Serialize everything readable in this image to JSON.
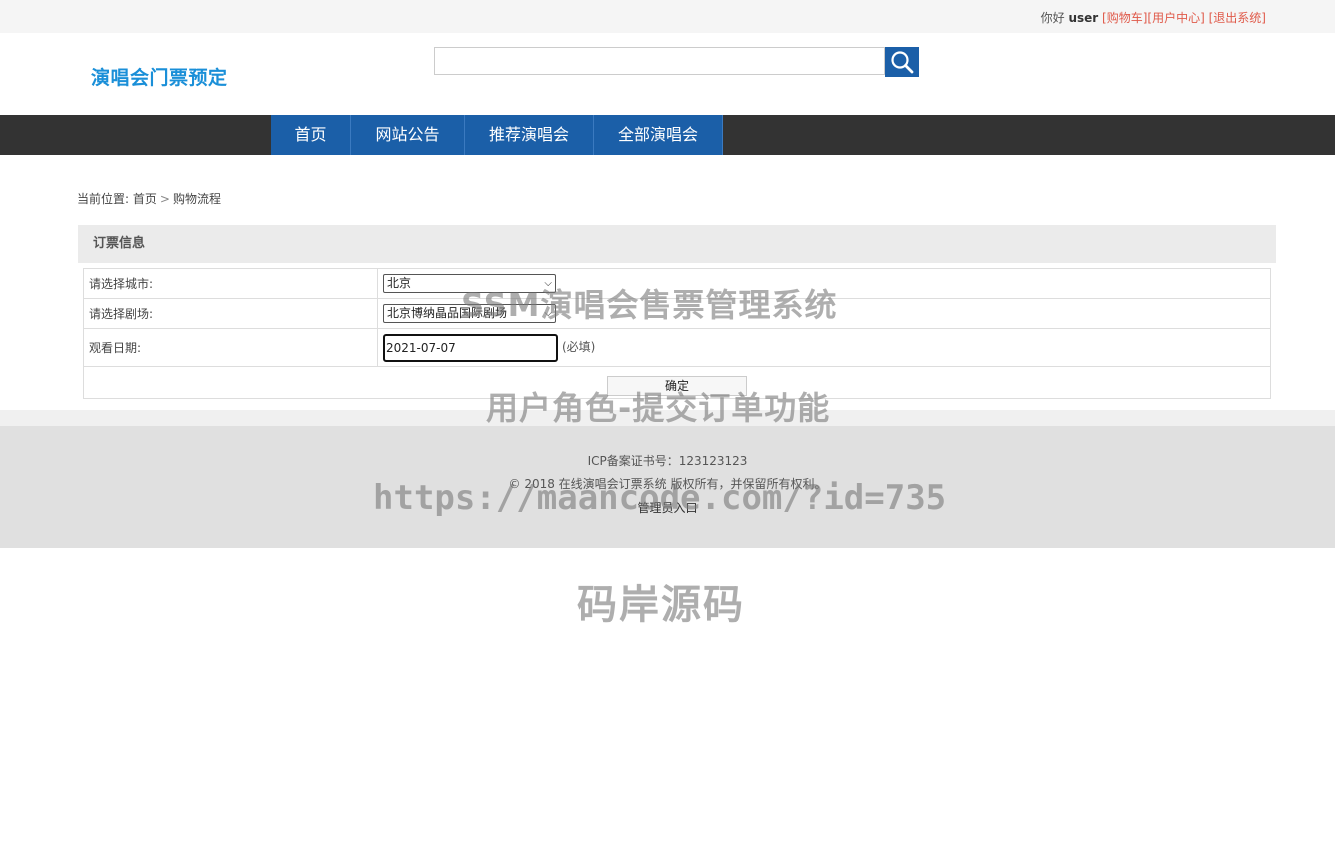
{
  "topbar": {
    "greeting": "你好",
    "username": "user",
    "cart_link": "[购物车]",
    "user_center_link": "[用户中心]",
    "logout_link": "[退出系统]"
  },
  "header": {
    "logo": "演唱会门票预定",
    "search_value": ""
  },
  "nav": {
    "items": [
      {
        "label": "首页"
      },
      {
        "label": "网站公告"
      },
      {
        "label": "推荐演唱会"
      },
      {
        "label": "全部演唱会"
      }
    ]
  },
  "breadcrumb": {
    "prefix": "当前位置:",
    "home": "首页",
    "sep": ">",
    "current": "购物流程"
  },
  "panel": {
    "title": "订票信息"
  },
  "form": {
    "city_label": "请选择城市:",
    "city_value": "北京",
    "theater_label": "请选择剧场:",
    "theater_value": "北京博纳晶品国际剧场",
    "date_label": "观看日期:",
    "date_value": "2021-07-07",
    "date_required": "(必填)",
    "submit_label": "确定"
  },
  "footer": {
    "icp": "ICP备案证书号：123123123",
    "copyright": "© 2018 在线演唱会订票系统 版权所有，并保留所有权利。",
    "admin_link": "管理员入口"
  },
  "watermarks": {
    "title": "SSM演唱会售票管理系统",
    "subtitle": "用户角色-提交订单功能",
    "url": "https://maancode.com/?id=735",
    "brand": "码岸源码"
  },
  "colors": {
    "accent": "#1b5fa8",
    "logo": "#1a8fd8",
    "link": "#e05a4a",
    "navbar": "#333333"
  }
}
